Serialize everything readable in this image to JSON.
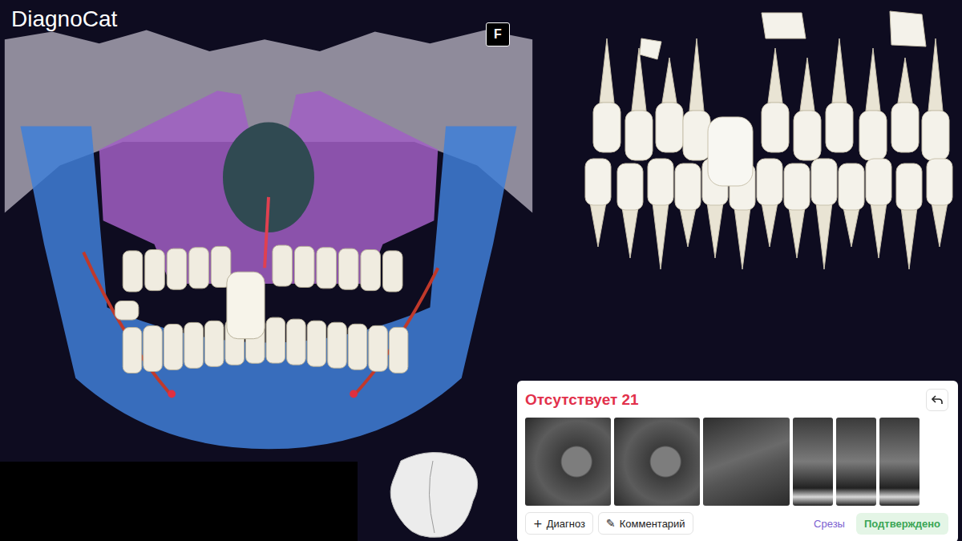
{
  "app": {
    "logo": "DiagnoCat",
    "view_badge": "F"
  },
  "finding": {
    "title": "Отсутствует 21",
    "confirmed": true,
    "slices": [
      {
        "kind": "axial"
      },
      {
        "kind": "axial"
      },
      {
        "kind": "sagittal"
      },
      {
        "kind": "coronal"
      },
      {
        "kind": "coronal"
      },
      {
        "kind": "coronal"
      }
    ],
    "actions": [
      {
        "icon": "+",
        "label": "Диагноз"
      },
      {
        "icon": "✎",
        "label": "Комментарий"
      }
    ],
    "slices_link": "Срезы",
    "status": "Подтверждено"
  }
}
